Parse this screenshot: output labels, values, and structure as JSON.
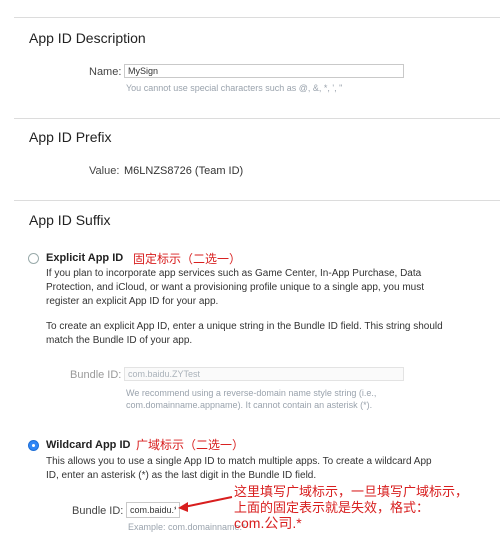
{
  "description": {
    "title": "App ID Description",
    "name_label": "Name:",
    "name_value": "MySign",
    "name_hint": "You cannot use special characters such as @, &, *, ', \""
  },
  "prefix": {
    "title": "App ID Prefix",
    "value_label": "Value:",
    "value": "M6LNZS8726 (Team ID)"
  },
  "suffix": {
    "title": "App ID Suffix",
    "explicit": {
      "label": "Explicit App ID",
      "annotation": "固定标示（二选一）",
      "desc_1": "If you plan to incorporate app services such as Game Center, In-App Purchase, Data Protection, and iCloud, or want a provisioning profile unique to a single app, you must register an explicit App ID for your app.",
      "desc_2": "To create an explicit App ID, enter a unique string in the Bundle ID field. This string should match the Bundle ID of your app.",
      "bundle_label": "Bundle ID:",
      "bundle_value": "com.baidu.ZYTest",
      "bundle_hint": "We recommend using a reverse-domain name style string (i.e., com.domainname.appname). It cannot contain an asterisk (*)."
    },
    "wildcard": {
      "label": "Wildcard App ID",
      "annotation": "广域标示（二选一）",
      "desc": "This allows you to use a single App ID to match multiple apps. To create a wildcard App ID, enter an asterisk (*) as the last digit in the Bundle ID field.",
      "bundle_label": "Bundle ID:",
      "bundle_value": "com.baidu.*",
      "bundle_hint": "Example: com.domainname.*",
      "note_1": "这里填写广域标示，一旦填写广域标示，",
      "note_2": "上面的固定表示就是失效，格式：",
      "note_3": "com.公司.*"
    }
  },
  "colors": {
    "accent": "#2f86f6",
    "annotation": "#d81e1e"
  }
}
